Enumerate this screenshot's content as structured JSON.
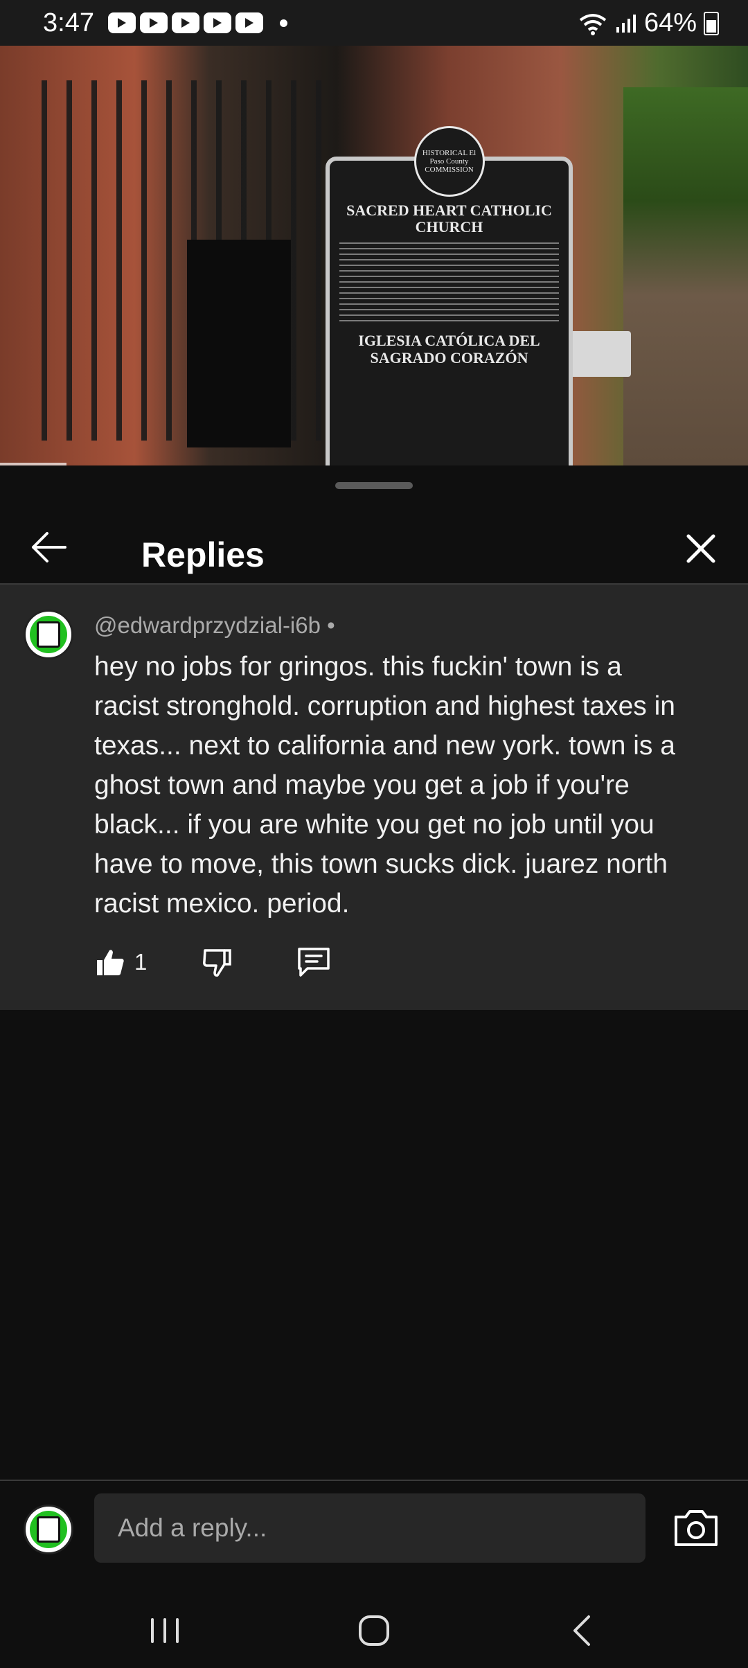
{
  "status_bar": {
    "time": "3:47",
    "battery": "64%",
    "notification_icons": [
      "youtube-icon",
      "youtube-icon",
      "youtube-icon",
      "youtube-icon",
      "youtube-icon"
    ]
  },
  "video": {
    "marker_seal": "HISTORICAL El Paso County COMMISSION",
    "marker_title": "SACRED HEART CATHOLIC CHURCH",
    "marker_title_es": "IGLESIA CATÓLICA DEL SAGRADO CORAZÓN"
  },
  "header": {
    "title": "Replies"
  },
  "comment": {
    "author": "@edwardprzydzial-i6b",
    "separator": " •",
    "text": "hey no jobs for gringos. this fuckin' town is a racist stronghold. corruption and highest taxes in texas... next to california and new york. town is a ghost town and maybe you get a job if you're black... if you are white you get no job until you have to move, this town sucks dick. juarez north racist mexico. period.",
    "likes": "1"
  },
  "reply": {
    "placeholder": "Add a reply..."
  },
  "colors": {
    "background": "#0f0f0f",
    "comment_bg": "#272727",
    "avatar_accent": "#21c020"
  }
}
